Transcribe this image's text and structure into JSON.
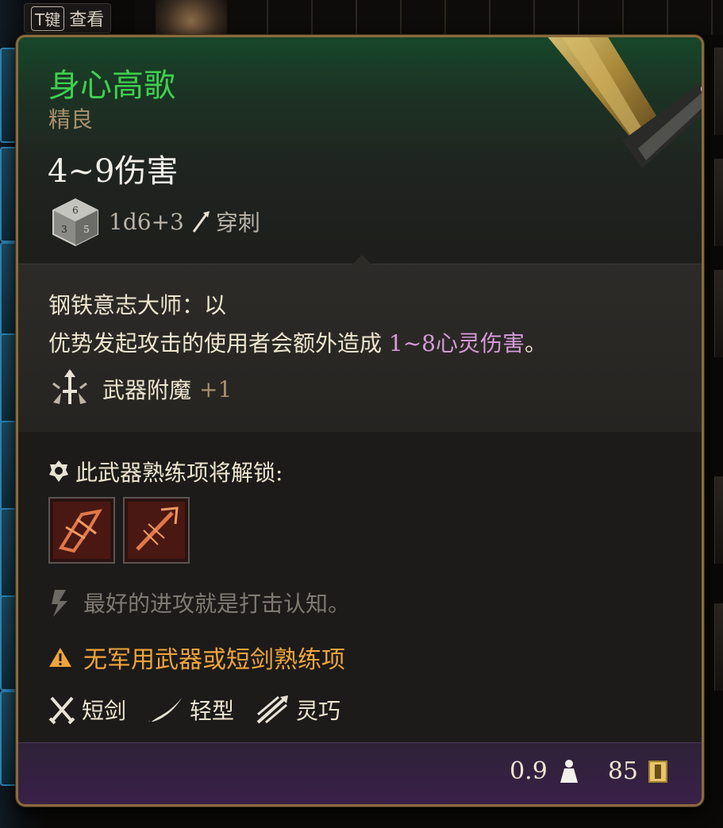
{
  "hint": {
    "key": "T键",
    "label": "查看"
  },
  "item": {
    "name": "身心高歌",
    "rarity": "精良",
    "damage": "4~9伤害",
    "roll": "1d6+3",
    "damage_type": "穿刺"
  },
  "description": {
    "line1": "钢铁意志大师：以",
    "line2_prefix": "优势发起攻击的使用者会额外造成 ",
    "line2_highlight": "1~8心灵伤害",
    "line2_suffix": "。"
  },
  "enchantment": {
    "label": "武器附魔",
    "value": "+1"
  },
  "proficiency": {
    "header": "此武器熟练项将解锁:",
    "skills": [
      "skill-slash",
      "skill-piercing-strike"
    ]
  },
  "flavor": "最好的进攻就是打击认知。",
  "warning": "无军用武器或短剑熟练项",
  "properties": [
    {
      "icon": "crossed-swords-icon",
      "label": "短剑"
    },
    {
      "icon": "feather-icon",
      "label": "轻型"
    },
    {
      "icon": "finesse-icon",
      "label": "灵巧"
    }
  ],
  "footer": {
    "weight": "0.9",
    "value": "85"
  },
  "colors": {
    "uncommon": "#3fd04f",
    "warning": "#f0a43c",
    "psychic": "#d59ad7"
  }
}
